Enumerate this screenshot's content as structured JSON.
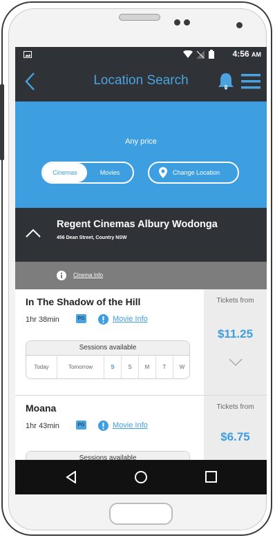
{
  "status": {
    "time": "4:56",
    "ampm": "AM"
  },
  "header": {
    "title": "Location Search",
    "notifications": "0"
  },
  "filter": {
    "price": "Any price",
    "tabs": [
      "Cinemas",
      "Movies"
    ],
    "change_location": "Change Location"
  },
  "cinema": {
    "name": "Regent Cinemas Albury Wodonga",
    "address": "456 Dean Street, Country NSW",
    "info_link": "Cinema Info"
  },
  "movies": [
    {
      "title": "In The Shadow of the Hill",
      "duration": "1hr 38min",
      "rating": "PG",
      "info_link": "Movie Info",
      "tickets_label": "Tickets from",
      "price": "$11.25",
      "sessions_label": "Sessions available",
      "days": [
        "Today",
        "Tomorrow",
        "S",
        "S",
        "M",
        "T",
        "W"
      ]
    },
    {
      "title": "Moana",
      "duration": "1hr 43min",
      "rating": "PG",
      "info_link": "Movie Info",
      "tickets_label": "Tickets from",
      "price": "$6.75",
      "sessions_label": "Sessions available"
    }
  ],
  "colors": {
    "accent": "#3d9ee0",
    "dark": "#2f3338",
    "gray_bar": "#7d7d7d"
  }
}
